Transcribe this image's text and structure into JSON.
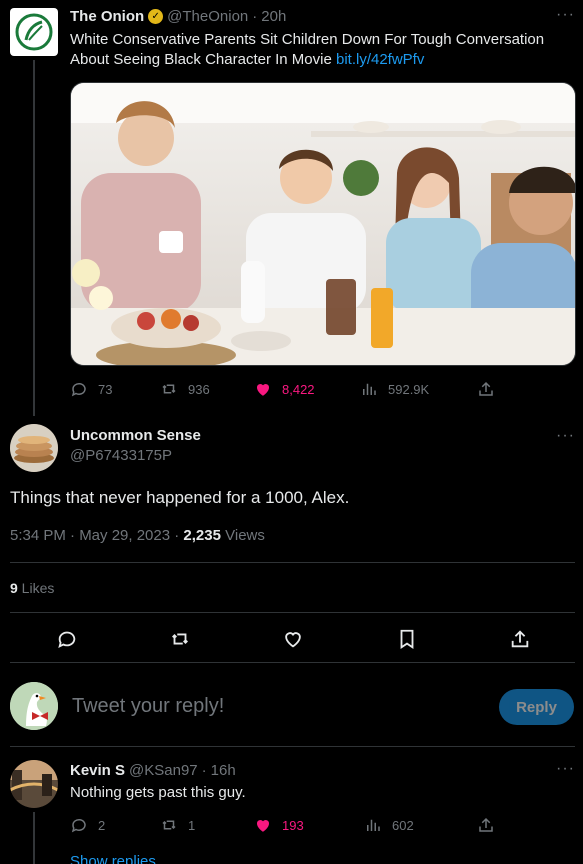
{
  "parent_tweet": {
    "author_name": "The Onion",
    "author_handle": "@TheOnion",
    "time": "20h",
    "text": "White Conservative Parents Sit Children Down For Tough Conversation About Seeing Black Character In Movie",
    "link": "bit.ly/42fwPfv",
    "stats": {
      "replies": "73",
      "retweets": "936",
      "likes": "8,422",
      "views": "592.9K"
    }
  },
  "focus_tweet": {
    "author_name": "Uncommon Sense",
    "author_handle": "@P67433175P",
    "text": "Things that never happened for a 1000, Alex.",
    "timestamp": "5:34 PM · May 29, 2023 · ",
    "views_count": "2,235",
    "views_label": " Views",
    "likes_count": "9",
    "likes_label": " Likes"
  },
  "reply_box": {
    "placeholder": "Tweet your reply!",
    "button_label": "Reply"
  },
  "reply_tweet": {
    "author_name": "Kevin S",
    "author_handle": "@KSan97",
    "time": "16h",
    "text": "Nothing gets past this guy.",
    "stats": {
      "replies": "2",
      "retweets": "1",
      "likes": "193",
      "views": "602"
    },
    "show_replies": "Show replies"
  },
  "colors": {
    "accent": "#1d9bf0",
    "like": "#f91880",
    "background": "#000000",
    "verified": "#e2b719"
  }
}
